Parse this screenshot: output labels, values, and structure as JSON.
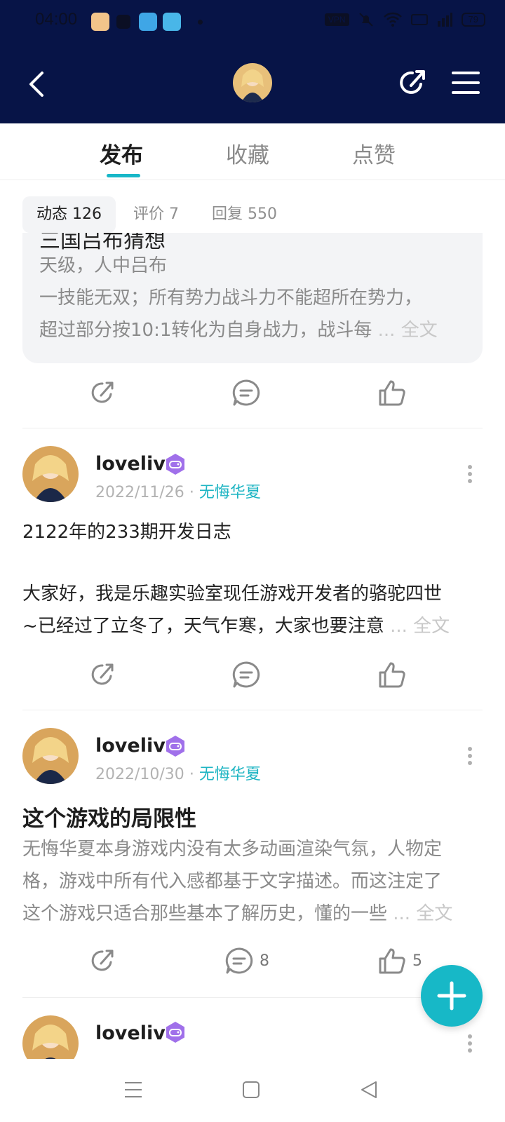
{
  "status_bar": {
    "time": "04:00",
    "vpn": "VPN",
    "battery": "79"
  },
  "header": {
    "back_icon": "back-arrow-icon",
    "share_icon": "share-icon",
    "menu_icon": "menu-icon"
  },
  "tabs": [
    {
      "label": "发布",
      "active": true
    },
    {
      "label": "收藏",
      "active": false
    },
    {
      "label": "点赞",
      "active": false
    }
  ],
  "subtabs": [
    {
      "label": "动态 126",
      "active": true
    },
    {
      "label": "评价 7",
      "active": false
    },
    {
      "label": "回复 550",
      "active": false
    }
  ],
  "card_top": {
    "title_cut": "三国吕布猜想",
    "line1": "天级，人中吕布",
    "line2": "一技能无双；所有势力战斗力不能超所在势力，",
    "line3": "超过部分按10:1转化为自身战力，战斗每",
    "more": "... 全文"
  },
  "posts": [
    {
      "name": "lovelive",
      "date": "2022/11/26",
      "sep": "·",
      "game": "无悔华夏",
      "line1": "2122年的233期开发日志",
      "line2": "大家好，我是乐趣实验室现任游戏开发者的骆驼四世",
      "line3": "~已经过了立冬了，天气乍寒，大家也要注意",
      "more": "... 全文"
    },
    {
      "name": "lovelive",
      "date": "2022/10/30",
      "sep": "·",
      "game": "无悔华夏",
      "title": "这个游戏的局限性",
      "line1": "无悔华夏本身游戏内没有太多动画渲染气氛，人物定",
      "line2": "格，游戏中所有代入感都基于文字描述。而这注定了",
      "line3": "这个游戏只适合那些基本了解历史，懂的一些",
      "more": "... 全文",
      "comment_count": "8",
      "like_count": "5"
    },
    {
      "name": "lovelive"
    }
  ],
  "colors": {
    "header_bg": "#071447",
    "accent": "#17b8c7",
    "badge": "#a070ea"
  }
}
